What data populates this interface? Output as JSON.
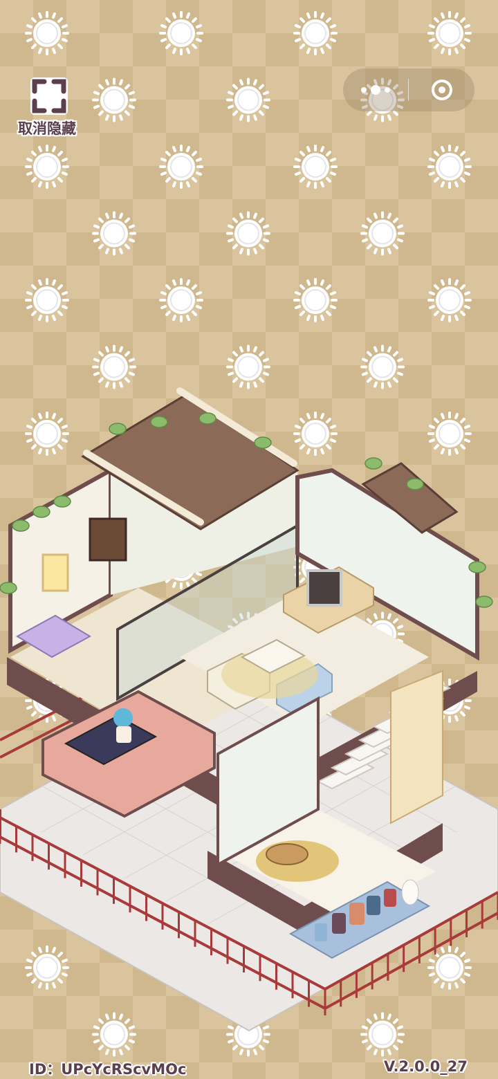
{
  "hide_button": {
    "label": "取消隐藏",
    "icon": "expand-corners-icon"
  },
  "capsule": {
    "more_icon": "more-dots-icon",
    "close_icon": "target-ring-icon"
  },
  "footer": {
    "id_text": "ID：UPcYcRScvMOc",
    "version": "V.2.0.0_27"
  },
  "colors": {
    "background_light": "#d9c49d",
    "background_dark": "#cfb88e",
    "roof": "#8c6a58",
    "wall": "#f4efe4",
    "floor": "#efe8d8",
    "railing": "#a83a3a",
    "text": "#5b3f4c"
  },
  "scene": {
    "description_icon": "isometric-house-icon"
  }
}
